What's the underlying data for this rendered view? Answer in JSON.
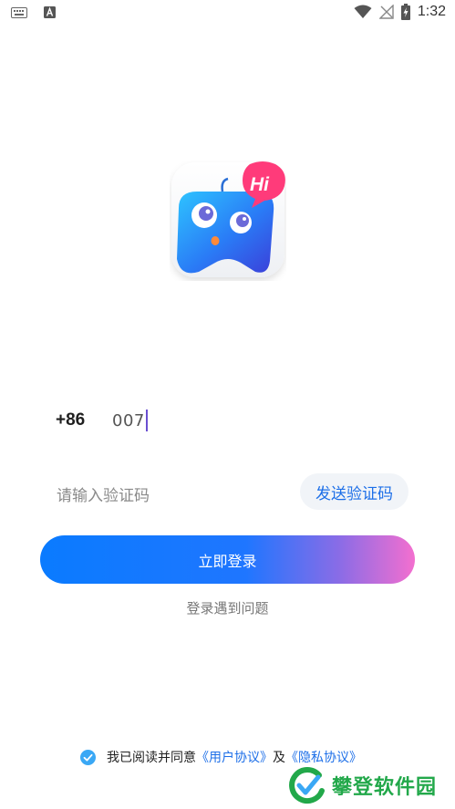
{
  "status_bar": {
    "time": "1:32",
    "icons": [
      "keyboard-icon",
      "a-notification-icon",
      "wifi-icon",
      "no-signal-icon",
      "battery-charging-icon"
    ]
  },
  "login": {
    "country_code": "+86",
    "phone_value": "007",
    "code_placeholder": "请输入验证码",
    "send_code_label": "发送验证码",
    "login_button_label": "立即登录",
    "trouble_link": "登录遇到问题"
  },
  "agreement": {
    "prefix": "我已阅读并同意",
    "user_agreement": "《用户协议》",
    "conjunction": "及",
    "privacy_policy": "《隐私协议》"
  },
  "watermark": {
    "text": "攀登软件园"
  },
  "colors": {
    "accent": "#1d6fe8",
    "gradient_start": "#0a7bff",
    "gradient_end": "#f36fcf",
    "check": "#3aa8f5",
    "watermark": "#22a84a"
  }
}
